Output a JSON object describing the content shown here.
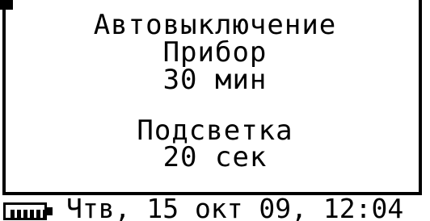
{
  "settings": {
    "auto_off_title": "Автовыключение",
    "device_label": "Прибор",
    "auto_off_value": "30 мин",
    "backlight_title": "Подсветка",
    "backlight_value": "20 сек"
  },
  "status_bar": {
    "battery_icon": "battery-full-icon",
    "battery_level": 1.0,
    "datetime": "Чтв, 15 окт 09, 12:04"
  }
}
